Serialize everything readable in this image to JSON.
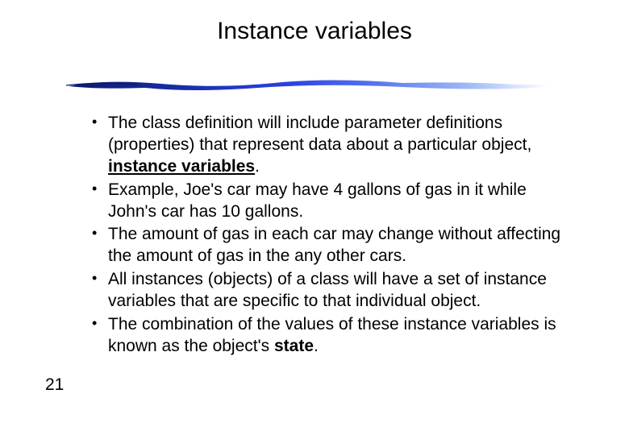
{
  "slide": {
    "title": "Instance variables",
    "page_number": "21",
    "bullets": [
      {
        "pre": "The class definition will include parameter definitions (properties) that represent data about a particular object, ",
        "em": "instance variables",
        "em_style": "underline-bold",
        "post": "."
      },
      {
        "pre": "Example, Joe's car may have 4 gallons of gas in it while John's car has 10 gallons.",
        "em": "",
        "em_style": "",
        "post": ""
      },
      {
        "pre": "The amount of gas in each car may change without affecting the amount of gas in the any other cars.",
        "em": "",
        "em_style": "",
        "post": ""
      },
      {
        "pre": "All instances (objects) of a class will have a set of instance variables that are specific to that individual object.",
        "em": "",
        "em_style": "",
        "post": ""
      },
      {
        "pre": "The combination of the values of these instance variables is known as the object's ",
        "em": "state",
        "em_style": "bold",
        "post": "."
      }
    ]
  }
}
